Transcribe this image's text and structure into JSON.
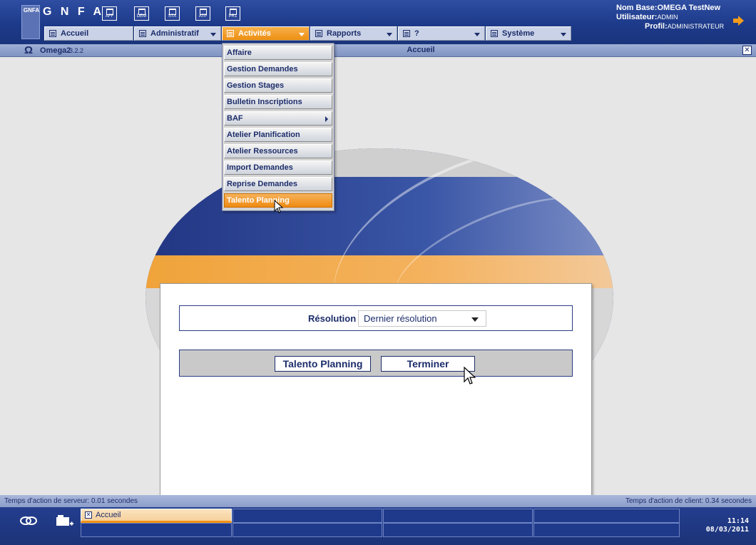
{
  "header": {
    "logo_text": "GNFA",
    "brand": "G N F A",
    "toolbar_icons": [
      {
        "name": "aff-icon",
        "label": "AFF"
      },
      {
        "name": "dem-icon",
        "label": "DEM"
      },
      {
        "name": "sta-icon",
        "label": "STA"
      },
      {
        "name": "atp-icon",
        "label": "ATP"
      },
      {
        "name": "pr-icon",
        "label": "PR1"
      }
    ],
    "menus": [
      {
        "label": "Accueil"
      },
      {
        "label": "Administratif"
      },
      {
        "label": "Activités"
      },
      {
        "label": "Rapports"
      },
      {
        "label": "?"
      },
      {
        "label": "Système"
      }
    ],
    "user": {
      "base_label": "Nom Base:",
      "base_value": "OMEGA TestNew",
      "user_label": "Utilisateur:",
      "user_value": "ADMIN",
      "profile_label": "Profil:",
      "profile_value": "ADMINISTRATEUR"
    }
  },
  "titlebar": {
    "app_name": "Omega2",
    "version": "3.2.2",
    "window_title": "Accueil",
    "close": "✕"
  },
  "dropdown": {
    "items": [
      {
        "label": "Affaire"
      },
      {
        "label": "Gestion Demandes"
      },
      {
        "label": "Gestion Stages"
      },
      {
        "label": "Bulletin Inscriptions"
      },
      {
        "label": "BAF"
      },
      {
        "label": "Atelier Planification"
      },
      {
        "label": "Atelier Ressources"
      },
      {
        "label": "Import Demandes"
      },
      {
        "label": "Reprise Demandes"
      },
      {
        "label": "Talento Planning"
      }
    ],
    "highlighted": "Talento Planning"
  },
  "dialog": {
    "resolution_label": "Résolution",
    "resolution_value": "Dernier résolution",
    "talento_button": "Talento Planning",
    "terminer_button": "Terminer"
  },
  "status": {
    "server": "Temps d'action de serveur: 0.01 secondes",
    "client": "Temps d'action de client: 0.34 secondes"
  },
  "taskbar": {
    "active_task": "Accueil",
    "time": "11:14",
    "date": "08/03/2011"
  },
  "colors": {
    "accent_orange": "#ef8b13",
    "navy": "#1c2d6b",
    "header_blue": "#1d3a8a"
  }
}
